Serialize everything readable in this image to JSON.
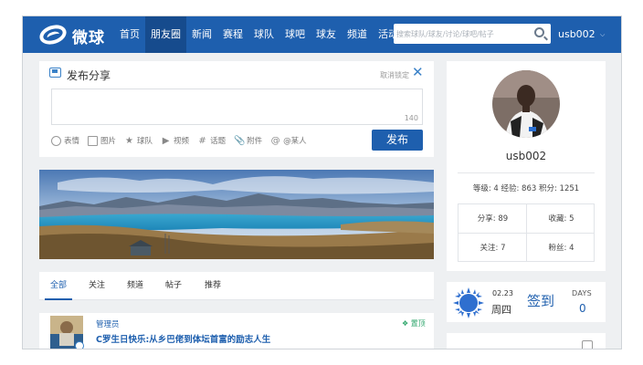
{
  "logo": {
    "text": "微球"
  },
  "nav": {
    "items": [
      {
        "label": "首页",
        "active": false
      },
      {
        "label": "朋友圈",
        "active": true
      },
      {
        "label": "新闻",
        "active": false
      },
      {
        "label": "赛程",
        "active": false
      },
      {
        "label": "球队",
        "active": false
      },
      {
        "label": "球吧",
        "active": false
      },
      {
        "label": "球友",
        "active": false
      },
      {
        "label": "频道",
        "active": false
      },
      {
        "label": "活动",
        "active": false
      }
    ],
    "search_placeholder": "搜索球队/球友/讨论/球吧/帖子",
    "username": "usb002",
    "dropdown_icon": "chevron-down-icon"
  },
  "composer": {
    "title": "发布分享",
    "unlock_label": "取消锁定",
    "char_count": "140",
    "tools": [
      {
        "label": "表情",
        "icon": "emoji-icon"
      },
      {
        "label": "图片",
        "icon": "image-icon"
      },
      {
        "label": "球队",
        "icon": "star-icon"
      },
      {
        "label": "视频",
        "icon": "video-icon"
      },
      {
        "label": "话题",
        "icon": "hashtag-icon"
      },
      {
        "label": "附件",
        "icon": "paperclip-icon"
      },
      {
        "label": "@某人",
        "icon": "at-icon"
      }
    ],
    "publish_label": "发布"
  },
  "feed": {
    "tabs": [
      {
        "label": "全部",
        "active": true
      },
      {
        "label": "关注",
        "active": false
      },
      {
        "label": "频道",
        "active": false
      },
      {
        "label": "帖子",
        "active": false
      },
      {
        "label": "推荐",
        "active": false
      }
    ],
    "items": [
      {
        "author": "管理员",
        "pin_label": "置顶",
        "title": "C罗生日快乐:从乡巴佬到体坛首富的励志人生"
      }
    ]
  },
  "profile": {
    "name": "usb002",
    "level_text": "等级: 4 经验: 863 积分: 1251",
    "stats": [
      {
        "label": "分享: 89"
      },
      {
        "label": "收藏: 5"
      },
      {
        "label": "关注: 7"
      },
      {
        "label": "粉丝: 4"
      }
    ]
  },
  "checkin": {
    "date": "02.23",
    "weekday": "周四",
    "button_label": "签到",
    "days_label": "DAYS",
    "days_value": "0"
  },
  "colors": {
    "brand": "#1e5fae",
    "page_bg": "#eef0f2",
    "pin_green": "#2ea66b"
  }
}
